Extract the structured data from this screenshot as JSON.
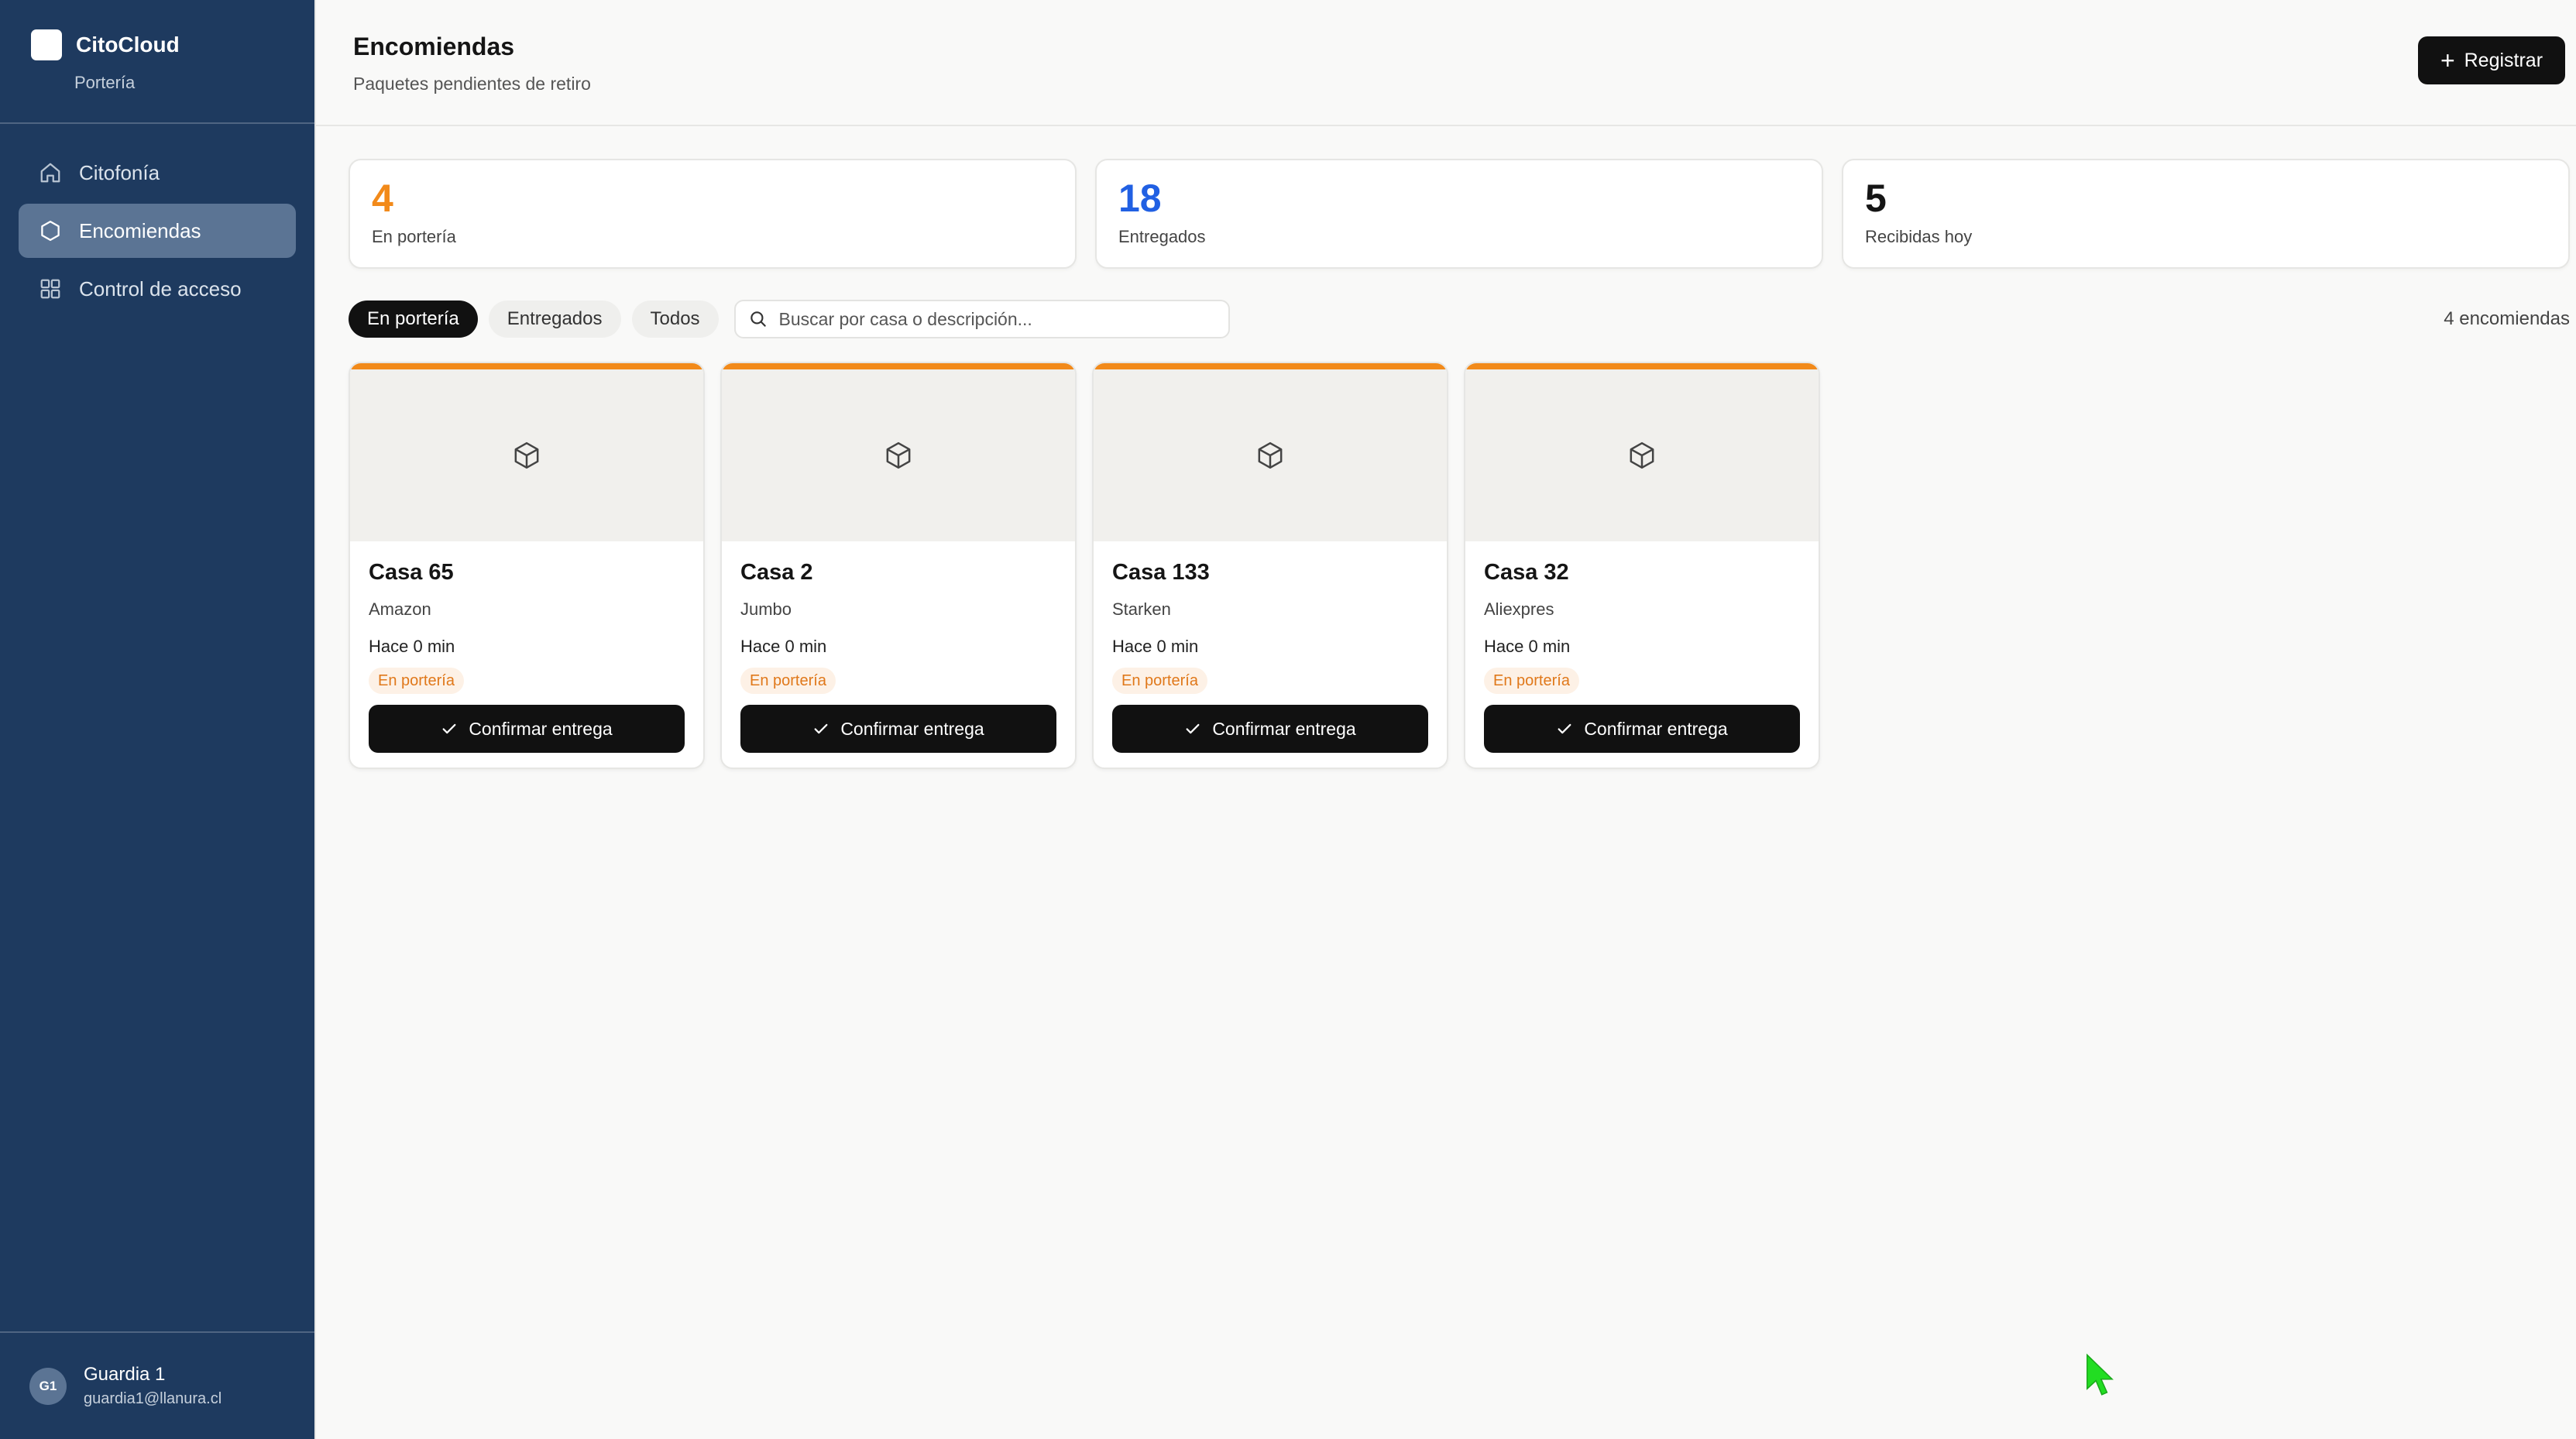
{
  "sidebar": {
    "brand": {
      "name": "CitoCloud",
      "subtitle": "Portería"
    },
    "items": [
      {
        "label": "Citofonía",
        "icon": "home-icon",
        "active": false
      },
      {
        "label": "Encomiendas",
        "icon": "package-icon",
        "active": true
      },
      {
        "label": "Control de acceso",
        "icon": "grid-icon",
        "active": false
      }
    ],
    "user": {
      "initials": "G1",
      "name": "Guardia 1",
      "email": "guardia1@llanura.cl"
    }
  },
  "header": {
    "title": "Encomiendas",
    "subtitle": "Paquetes pendientes de retiro",
    "register_label": "Registrar"
  },
  "stats": [
    {
      "value": "4",
      "label": "En portería",
      "color": "#f28a1a"
    },
    {
      "value": "18",
      "label": "Entregados",
      "color": "#2160e3"
    },
    {
      "value": "5",
      "label": "Recibidas hoy",
      "color": "#151515"
    }
  ],
  "filters": {
    "tabs": [
      {
        "label": "En portería",
        "active": true
      },
      {
        "label": "Entregados",
        "active": false
      },
      {
        "label": "Todos",
        "active": false
      }
    ],
    "search_placeholder": "Buscar por casa o descripción...",
    "count": "4 encomiendas"
  },
  "packages": [
    {
      "title": "Casa 65",
      "carrier": "Amazon",
      "time": "Hace 0 min",
      "status": "En portería",
      "action": "Confirmar entrega"
    },
    {
      "title": "Casa 2",
      "carrier": "Jumbo",
      "time": "Hace 0 min",
      "status": "En portería",
      "action": "Confirmar entrega"
    },
    {
      "title": "Casa 133",
      "carrier": "Starken",
      "time": "Hace 0 min",
      "status": "En portería",
      "action": "Confirmar entrega"
    },
    {
      "title": "Casa 32",
      "carrier": "Aliexpres",
      "time": "Hace 0 min",
      "status": "En portería",
      "action": "Confirmar entrega"
    }
  ],
  "colors": {
    "sidebar": "#1e3a5f",
    "accent": "#f28a1a",
    "primary": "#111111"
  }
}
